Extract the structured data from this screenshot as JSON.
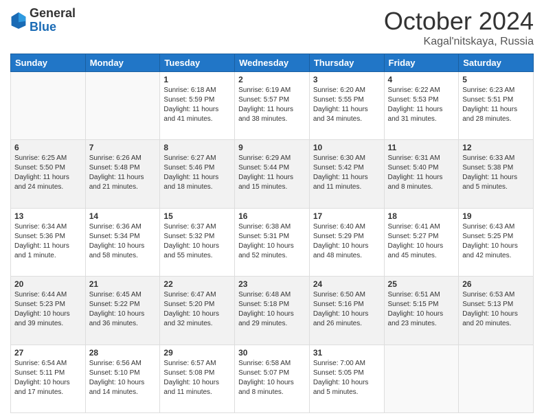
{
  "header": {
    "logo_general": "General",
    "logo_blue": "Blue",
    "month_title": "October 2024",
    "subtitle": "Kagal'nitskaya, Russia"
  },
  "days_of_week": [
    "Sunday",
    "Monday",
    "Tuesday",
    "Wednesday",
    "Thursday",
    "Friday",
    "Saturday"
  ],
  "weeks": [
    [
      {
        "num": "",
        "info": ""
      },
      {
        "num": "",
        "info": ""
      },
      {
        "num": "1",
        "info": "Sunrise: 6:18 AM\nSunset: 5:59 PM\nDaylight: 11 hours and 41 minutes."
      },
      {
        "num": "2",
        "info": "Sunrise: 6:19 AM\nSunset: 5:57 PM\nDaylight: 11 hours and 38 minutes."
      },
      {
        "num": "3",
        "info": "Sunrise: 6:20 AM\nSunset: 5:55 PM\nDaylight: 11 hours and 34 minutes."
      },
      {
        "num": "4",
        "info": "Sunrise: 6:22 AM\nSunset: 5:53 PM\nDaylight: 11 hours and 31 minutes."
      },
      {
        "num": "5",
        "info": "Sunrise: 6:23 AM\nSunset: 5:51 PM\nDaylight: 11 hours and 28 minutes."
      }
    ],
    [
      {
        "num": "6",
        "info": "Sunrise: 6:25 AM\nSunset: 5:50 PM\nDaylight: 11 hours and 24 minutes."
      },
      {
        "num": "7",
        "info": "Sunrise: 6:26 AM\nSunset: 5:48 PM\nDaylight: 11 hours and 21 minutes."
      },
      {
        "num": "8",
        "info": "Sunrise: 6:27 AM\nSunset: 5:46 PM\nDaylight: 11 hours and 18 minutes."
      },
      {
        "num": "9",
        "info": "Sunrise: 6:29 AM\nSunset: 5:44 PM\nDaylight: 11 hours and 15 minutes."
      },
      {
        "num": "10",
        "info": "Sunrise: 6:30 AM\nSunset: 5:42 PM\nDaylight: 11 hours and 11 minutes."
      },
      {
        "num": "11",
        "info": "Sunrise: 6:31 AM\nSunset: 5:40 PM\nDaylight: 11 hours and 8 minutes."
      },
      {
        "num": "12",
        "info": "Sunrise: 6:33 AM\nSunset: 5:38 PM\nDaylight: 11 hours and 5 minutes."
      }
    ],
    [
      {
        "num": "13",
        "info": "Sunrise: 6:34 AM\nSunset: 5:36 PM\nDaylight: 11 hours and 1 minute."
      },
      {
        "num": "14",
        "info": "Sunrise: 6:36 AM\nSunset: 5:34 PM\nDaylight: 10 hours and 58 minutes."
      },
      {
        "num": "15",
        "info": "Sunrise: 6:37 AM\nSunset: 5:32 PM\nDaylight: 10 hours and 55 minutes."
      },
      {
        "num": "16",
        "info": "Sunrise: 6:38 AM\nSunset: 5:31 PM\nDaylight: 10 hours and 52 minutes."
      },
      {
        "num": "17",
        "info": "Sunrise: 6:40 AM\nSunset: 5:29 PM\nDaylight: 10 hours and 48 minutes."
      },
      {
        "num": "18",
        "info": "Sunrise: 6:41 AM\nSunset: 5:27 PM\nDaylight: 10 hours and 45 minutes."
      },
      {
        "num": "19",
        "info": "Sunrise: 6:43 AM\nSunset: 5:25 PM\nDaylight: 10 hours and 42 minutes."
      }
    ],
    [
      {
        "num": "20",
        "info": "Sunrise: 6:44 AM\nSunset: 5:23 PM\nDaylight: 10 hours and 39 minutes."
      },
      {
        "num": "21",
        "info": "Sunrise: 6:45 AM\nSunset: 5:22 PM\nDaylight: 10 hours and 36 minutes."
      },
      {
        "num": "22",
        "info": "Sunrise: 6:47 AM\nSunset: 5:20 PM\nDaylight: 10 hours and 32 minutes."
      },
      {
        "num": "23",
        "info": "Sunrise: 6:48 AM\nSunset: 5:18 PM\nDaylight: 10 hours and 29 minutes."
      },
      {
        "num": "24",
        "info": "Sunrise: 6:50 AM\nSunset: 5:16 PM\nDaylight: 10 hours and 26 minutes."
      },
      {
        "num": "25",
        "info": "Sunrise: 6:51 AM\nSunset: 5:15 PM\nDaylight: 10 hours and 23 minutes."
      },
      {
        "num": "26",
        "info": "Sunrise: 6:53 AM\nSunset: 5:13 PM\nDaylight: 10 hours and 20 minutes."
      }
    ],
    [
      {
        "num": "27",
        "info": "Sunrise: 6:54 AM\nSunset: 5:11 PM\nDaylight: 10 hours and 17 minutes."
      },
      {
        "num": "28",
        "info": "Sunrise: 6:56 AM\nSunset: 5:10 PM\nDaylight: 10 hours and 14 minutes."
      },
      {
        "num": "29",
        "info": "Sunrise: 6:57 AM\nSunset: 5:08 PM\nDaylight: 10 hours and 11 minutes."
      },
      {
        "num": "30",
        "info": "Sunrise: 6:58 AM\nSunset: 5:07 PM\nDaylight: 10 hours and 8 minutes."
      },
      {
        "num": "31",
        "info": "Sunrise: 7:00 AM\nSunset: 5:05 PM\nDaylight: 10 hours and 5 minutes."
      },
      {
        "num": "",
        "info": ""
      },
      {
        "num": "",
        "info": ""
      }
    ]
  ]
}
